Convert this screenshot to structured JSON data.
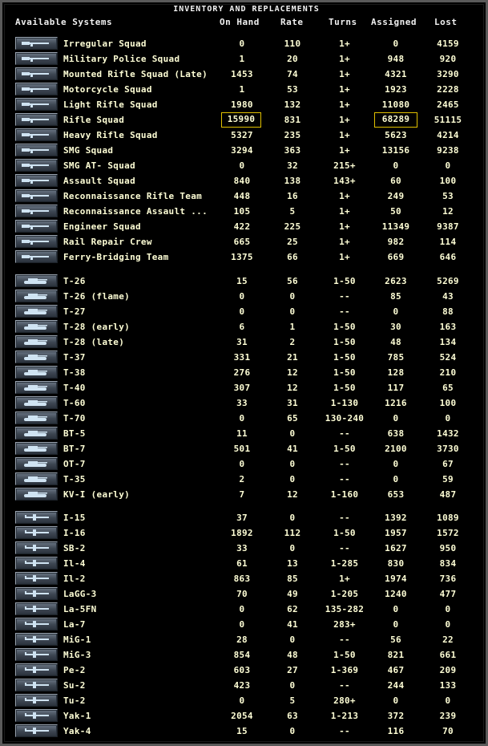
{
  "window": {
    "title": "INVENTORY AND REPLACEMENTS"
  },
  "columns": {
    "name": "Available Systems",
    "on_hand": "On Hand",
    "rate": "Rate",
    "turns": "Turns",
    "assigned": "Assigned",
    "lost": "Lost"
  },
  "groups": [
    {
      "icon": "infantry-rifle-icon",
      "rows": [
        {
          "name": "Irregular Squad",
          "on_hand": "0",
          "rate": "110",
          "turns": "1+",
          "assigned": "0",
          "lost": "4159"
        },
        {
          "name": "Military Police Squad",
          "on_hand": "1",
          "rate": "20",
          "turns": "1+",
          "assigned": "948",
          "lost": "920"
        },
        {
          "name": "Mounted Rifle Squad (Late)",
          "on_hand": "1453",
          "rate": "74",
          "turns": "1+",
          "assigned": "4321",
          "lost": "3290"
        },
        {
          "name": "Motorcycle Squad",
          "on_hand": "1",
          "rate": "53",
          "turns": "1+",
          "assigned": "1923",
          "lost": "2228"
        },
        {
          "name": "Light Rifle Squad",
          "on_hand": "1980",
          "rate": "132",
          "turns": "1+",
          "assigned": "11080",
          "lost": "2465"
        },
        {
          "name": "Rifle Squad",
          "on_hand": "15990",
          "rate": "831",
          "turns": "1+",
          "assigned": "68289",
          "lost": "51115",
          "highlight": true
        },
        {
          "name": "Heavy Rifle Squad",
          "on_hand": "5327",
          "rate": "235",
          "turns": "1+",
          "assigned": "5623",
          "lost": "4214"
        },
        {
          "name": "SMG Squad",
          "on_hand": "3294",
          "rate": "363",
          "turns": "1+",
          "assigned": "13156",
          "lost": "9238"
        },
        {
          "name": "SMG AT- Squad",
          "on_hand": "0",
          "rate": "32",
          "turns": "215+",
          "assigned": "0",
          "lost": "0"
        },
        {
          "name": "Assault Squad",
          "on_hand": "840",
          "rate": "138",
          "turns": "143+",
          "assigned": "60",
          "lost": "100"
        },
        {
          "name": "Reconnaissance Rifle Team",
          "on_hand": "448",
          "rate": "16",
          "turns": "1+",
          "assigned": "249",
          "lost": "53"
        },
        {
          "name": "Reconnaissance Assault ...",
          "on_hand": "105",
          "rate": "5",
          "turns": "1+",
          "assigned": "50",
          "lost": "12"
        },
        {
          "name": "Engineer Squad",
          "on_hand": "422",
          "rate": "225",
          "turns": "1+",
          "assigned": "11349",
          "lost": "9387"
        },
        {
          "name": "Rail Repair Crew",
          "on_hand": "665",
          "rate": "25",
          "turns": "1+",
          "assigned": "982",
          "lost": "114"
        },
        {
          "name": "Ferry-Bridging Team",
          "on_hand": "1375",
          "rate": "66",
          "turns": "1+",
          "assigned": "669",
          "lost": "646"
        }
      ]
    },
    {
      "icon": "tank-icon",
      "rows": [
        {
          "name": "T-26",
          "on_hand": "15",
          "rate": "56",
          "turns": "1-50",
          "assigned": "2623",
          "lost": "5269"
        },
        {
          "name": "T-26 (flame)",
          "on_hand": "0",
          "rate": "0",
          "turns": "--",
          "assigned": "85",
          "lost": "43"
        },
        {
          "name": "T-27",
          "on_hand": "0",
          "rate": "0",
          "turns": "--",
          "assigned": "0",
          "lost": "88"
        },
        {
          "name": "T-28 (early)",
          "on_hand": "6",
          "rate": "1",
          "turns": "1-50",
          "assigned": "30",
          "lost": "163"
        },
        {
          "name": "T-28 (late)",
          "on_hand": "31",
          "rate": "2",
          "turns": "1-50",
          "assigned": "48",
          "lost": "134"
        },
        {
          "name": "T-37",
          "on_hand": "331",
          "rate": "21",
          "turns": "1-50",
          "assigned": "785",
          "lost": "524"
        },
        {
          "name": "T-38",
          "on_hand": "276",
          "rate": "12",
          "turns": "1-50",
          "assigned": "128",
          "lost": "210"
        },
        {
          "name": "T-40",
          "on_hand": "307",
          "rate": "12",
          "turns": "1-50",
          "assigned": "117",
          "lost": "65"
        },
        {
          "name": "T-60",
          "on_hand": "33",
          "rate": "31",
          "turns": "1-130",
          "assigned": "1216",
          "lost": "100"
        },
        {
          "name": "T-70",
          "on_hand": "0",
          "rate": "65",
          "turns": "130-240",
          "assigned": "0",
          "lost": "0"
        },
        {
          "name": "BT-5",
          "on_hand": "11",
          "rate": "0",
          "turns": "--",
          "assigned": "638",
          "lost": "1432"
        },
        {
          "name": "BT-7",
          "on_hand": "501",
          "rate": "41",
          "turns": "1-50",
          "assigned": "2100",
          "lost": "3730"
        },
        {
          "name": "OT-7",
          "on_hand": "0",
          "rate": "0",
          "turns": "--",
          "assigned": "0",
          "lost": "67"
        },
        {
          "name": "T-35",
          "on_hand": "2",
          "rate": "0",
          "turns": "--",
          "assigned": "0",
          "lost": "59"
        },
        {
          "name": "KV-I (early)",
          "on_hand": "7",
          "rate": "12",
          "turns": "1-160",
          "assigned": "653",
          "lost": "487"
        }
      ]
    },
    {
      "icon": "aircraft-icon",
      "rows": [
        {
          "name": "I-15",
          "on_hand": "37",
          "rate": "0",
          "turns": "--",
          "assigned": "1392",
          "lost": "1089"
        },
        {
          "name": "I-16",
          "on_hand": "1892",
          "rate": "112",
          "turns": "1-50",
          "assigned": "1957",
          "lost": "1572"
        },
        {
          "name": "SB-2",
          "on_hand": "33",
          "rate": "0",
          "turns": "--",
          "assigned": "1627",
          "lost": "950"
        },
        {
          "name": "Il-4",
          "on_hand": "61",
          "rate": "13",
          "turns": "1-285",
          "assigned": "830",
          "lost": "834"
        },
        {
          "name": "Il-2",
          "on_hand": "863",
          "rate": "85",
          "turns": "1+",
          "assigned": "1974",
          "lost": "736"
        },
        {
          "name": "LaGG-3",
          "on_hand": "70",
          "rate": "49",
          "turns": "1-205",
          "assigned": "1240",
          "lost": "477"
        },
        {
          "name": "La-5FN",
          "on_hand": "0",
          "rate": "62",
          "turns": "135-282",
          "assigned": "0",
          "lost": "0"
        },
        {
          "name": "La-7",
          "on_hand": "0",
          "rate": "41",
          "turns": "283+",
          "assigned": "0",
          "lost": "0"
        },
        {
          "name": "MiG-1",
          "on_hand": "28",
          "rate": "0",
          "turns": "--",
          "assigned": "56",
          "lost": "22"
        },
        {
          "name": "MiG-3",
          "on_hand": "854",
          "rate": "48",
          "turns": "1-50",
          "assigned": "821",
          "lost": "661"
        },
        {
          "name": "Pe-2",
          "on_hand": "603",
          "rate": "27",
          "turns": "1-369",
          "assigned": "467",
          "lost": "209"
        },
        {
          "name": "Su-2",
          "on_hand": "423",
          "rate": "0",
          "turns": "--",
          "assigned": "244",
          "lost": "133"
        },
        {
          "name": "Tu-2",
          "on_hand": "0",
          "rate": "5",
          "turns": "280+",
          "assigned": "0",
          "lost": "0"
        },
        {
          "name": "Yak-1",
          "on_hand": "2054",
          "rate": "63",
          "turns": "1-213",
          "assigned": "372",
          "lost": "239"
        },
        {
          "name": "Yak-4",
          "on_hand": "15",
          "rate": "0",
          "turns": "--",
          "assigned": "116",
          "lost": "70"
        }
      ]
    }
  ]
}
